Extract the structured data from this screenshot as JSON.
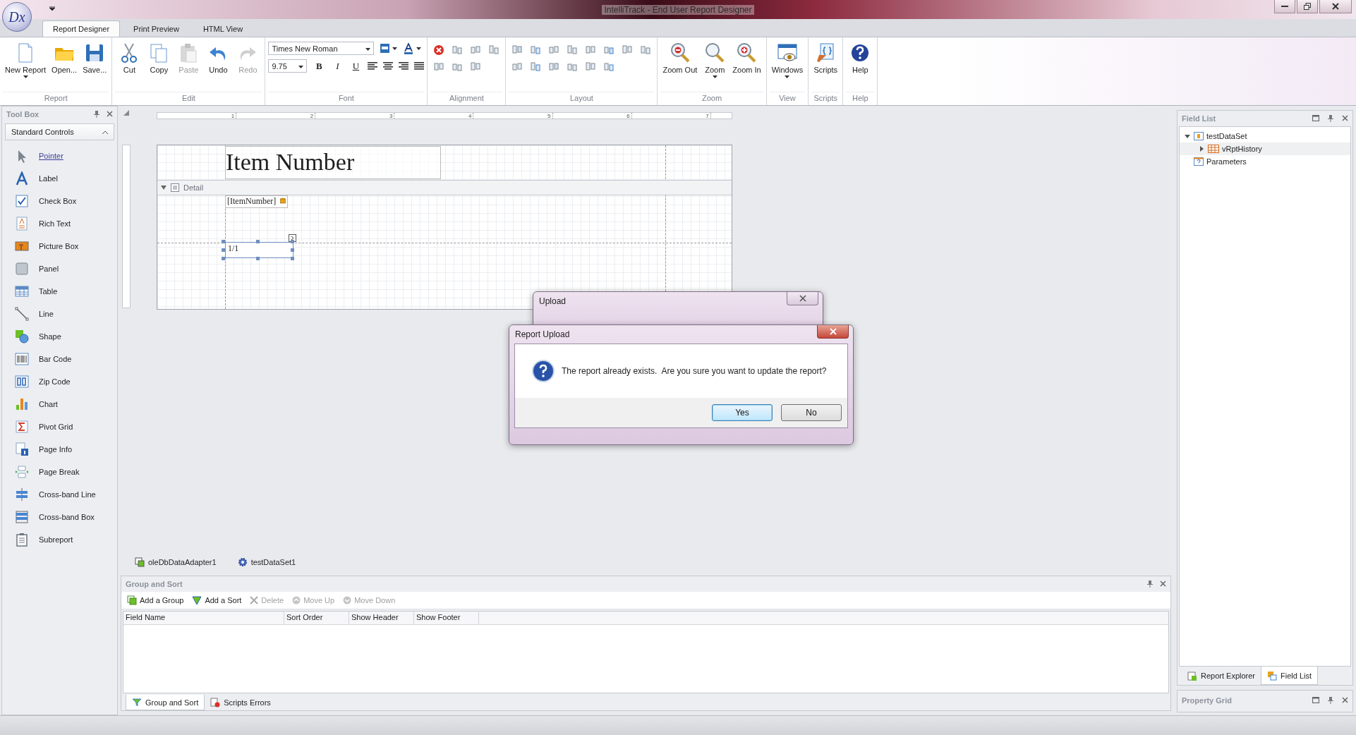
{
  "window": {
    "title": "IntelliTrack - End User Report Designer",
    "logo": "Dx"
  },
  "ribbon_tabs": [
    {
      "label": "Report Designer",
      "selected": true
    },
    {
      "label": "Print Preview",
      "selected": false
    },
    {
      "label": "HTML View",
      "selected": false
    }
  ],
  "ribbon_groups": [
    {
      "label": "Report",
      "kind": "buttons",
      "buttons": [
        {
          "label": "New Report",
          "dropdown": true,
          "disabled": false
        },
        {
          "label": "Open...",
          "dropdown": false,
          "disabled": false
        },
        {
          "label": "Save...",
          "dropdown": false,
          "disabled": false
        }
      ]
    },
    {
      "label": "Edit",
      "kind": "buttons",
      "buttons": [
        {
          "label": "Cut",
          "dropdown": false,
          "disabled": false
        },
        {
          "label": "Copy",
          "dropdown": false,
          "disabled": false
        },
        {
          "label": "Paste",
          "dropdown": false,
          "disabled": true
        },
        {
          "label": "Undo",
          "dropdown": false,
          "disabled": false
        },
        {
          "label": "Redo",
          "dropdown": false,
          "disabled": true
        }
      ]
    },
    {
      "label": "Font",
      "kind": "font",
      "font_name": "Times New Roman",
      "font_size": "9.75",
      "styles": [
        "B",
        "I",
        "U"
      ]
    },
    {
      "label": "Alignment",
      "kind": "alignment"
    },
    {
      "label": "Layout",
      "kind": "layout"
    },
    {
      "label": "Zoom",
      "kind": "buttons",
      "buttons": [
        {
          "label": "Zoom Out",
          "dropdown": false,
          "disabled": false
        },
        {
          "label": "Zoom",
          "dropdown": true,
          "disabled": false
        },
        {
          "label": "Zoom In",
          "dropdown": false,
          "disabled": false
        }
      ]
    },
    {
      "label": "View",
      "kind": "buttons",
      "buttons": [
        {
          "label": "Windows",
          "dropdown": true,
          "disabled": false
        }
      ]
    },
    {
      "label": "Scripts",
      "kind": "buttons",
      "buttons": [
        {
          "label": "Scripts",
          "dropdown": false,
          "disabled": false
        }
      ]
    },
    {
      "label": "Help",
      "kind": "buttons",
      "buttons": [
        {
          "label": "Help",
          "dropdown": false,
          "disabled": false
        }
      ]
    }
  ],
  "toolbox": {
    "title": "Tool Box",
    "category": "Standard Controls",
    "items": [
      {
        "label": "Pointer",
        "selected": true
      },
      {
        "label": "Label",
        "selected": false
      },
      {
        "label": "Check Box",
        "selected": false
      },
      {
        "label": "Rich Text",
        "selected": false
      },
      {
        "label": "Picture Box",
        "selected": false
      },
      {
        "label": "Panel",
        "selected": false
      },
      {
        "label": "Table",
        "selected": false
      },
      {
        "label": "Line",
        "selected": false
      },
      {
        "label": "Shape",
        "selected": false
      },
      {
        "label": "Bar Code",
        "selected": false
      },
      {
        "label": "Zip Code",
        "selected": false
      },
      {
        "label": "Chart",
        "selected": false
      },
      {
        "label": "Pivot Grid",
        "selected": false
      },
      {
        "label": "Page Info",
        "selected": false
      },
      {
        "label": "Page Break",
        "selected": false
      },
      {
        "label": "Cross-band Line",
        "selected": false
      },
      {
        "label": "Cross-band Box",
        "selected": false
      },
      {
        "label": "Subreport",
        "selected": false
      }
    ]
  },
  "designer": {
    "ruler_labels": [
      "1",
      "2",
      "3",
      "4",
      "5",
      "6",
      "7"
    ],
    "header_label": "Item Number",
    "detail_band": "Detail",
    "field_label": "[ItemNumber]",
    "selected_label": "1/1",
    "tray": [
      "oleDbDataAdapter1",
      "testDataSet1"
    ]
  },
  "group_and_sort": {
    "title": "Group and Sort",
    "toolbar": [
      {
        "label": "Add a Group",
        "disabled": false
      },
      {
        "label": "Add a Sort",
        "disabled": false
      },
      {
        "label": "Delete",
        "disabled": true
      },
      {
        "label": "Move Up",
        "disabled": true
      },
      {
        "label": "Move Down",
        "disabled": true
      }
    ],
    "columns": [
      "Field Name",
      "Sort Order",
      "Show Header",
      "Show Footer"
    ],
    "tabs": [
      {
        "label": "Group and Sort",
        "selected": true
      },
      {
        "label": "Scripts Errors",
        "selected": false
      }
    ]
  },
  "field_list": {
    "title": "Field List",
    "tree": [
      {
        "label": "testDataSet",
        "expanded": true,
        "selected": false,
        "children": [
          {
            "label": "vRptHistory",
            "expanded": false,
            "selected": true
          }
        ]
      },
      {
        "label": "Parameters",
        "selected": false
      }
    ],
    "tabs": [
      {
        "label": "Report Explorer",
        "selected": false
      },
      {
        "label": "Field List",
        "selected": true
      }
    ]
  },
  "property_grid": {
    "title": "Property Grid"
  },
  "dialogs": {
    "upload": {
      "title": "Upload"
    },
    "confirm": {
      "title": "Report Upload",
      "message": "The report already exists.  Are you sure you want to update the report?",
      "buttons": [
        {
          "label": "Yes",
          "default": true
        },
        {
          "label": "No",
          "default": false
        }
      ]
    }
  }
}
